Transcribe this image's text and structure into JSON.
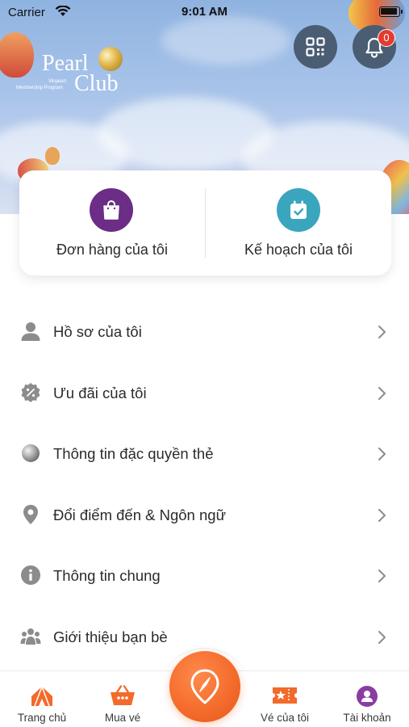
{
  "status_bar": {
    "carrier": "Carrier",
    "time": "9:01 AM"
  },
  "brand": {
    "logo_word1": "Pearl",
    "logo_word2": "Club",
    "logo_sub1": "Vinpearl",
    "logo_sub2": "Membership Program"
  },
  "header": {
    "qr_icon": "qr-code-icon",
    "bell_icon": "bell-icon",
    "notification_count": "0"
  },
  "quick_actions": [
    {
      "label": "Đơn hàng của tôi",
      "icon": "shopping-bag-icon",
      "color": "#6b2d86"
    },
    {
      "label": "Kế hoạch của tôi",
      "icon": "calendar-check-icon",
      "color": "#3aa6be"
    }
  ],
  "menu": {
    "items": [
      {
        "label": "Hồ sơ của tôi",
        "icon": "person-icon"
      },
      {
        "label": "Ưu đãi của tôi",
        "icon": "discount-badge-icon"
      },
      {
        "label": "Thông tin đặc quyền thẻ",
        "icon": "pearl-card-icon"
      },
      {
        "label": "Đổi điểm đến & Ngôn ngữ",
        "icon": "location-pin-icon"
      },
      {
        "label": "Thông tin chung",
        "icon": "info-icon"
      },
      {
        "label": "Giới thiệu bạn bè",
        "icon": "group-icon"
      }
    ]
  },
  "bottom_nav": {
    "items": [
      {
        "label": "Trang chủ",
        "icon": "home-tent-icon"
      },
      {
        "label": "Mua vé",
        "icon": "basket-icon"
      },
      {
        "label": "Vé của tôi",
        "icon": "ticket-icon"
      },
      {
        "label": "Tài khoản",
        "icon": "account-icon"
      }
    ],
    "center_icon": "explore-pin-icon"
  },
  "colors": {
    "accent": "#f36a2a",
    "purple": "#6b2d86",
    "teal": "#3aa6be",
    "badge": "#e23b30",
    "header_button": "#4a5d73",
    "icon_gray": "#8c8c8c"
  }
}
